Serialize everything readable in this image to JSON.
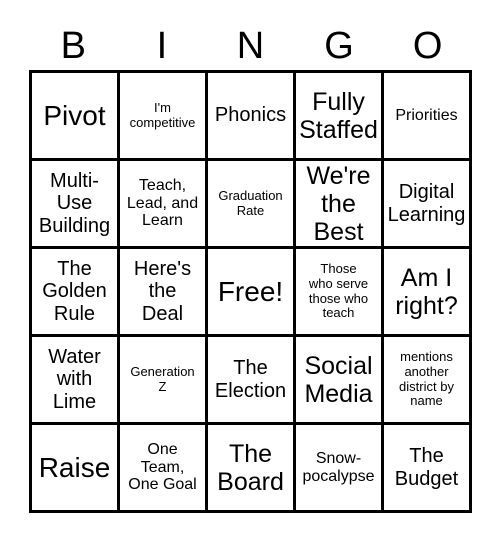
{
  "card": {
    "header_letters": [
      "B",
      "I",
      "N",
      "G",
      "O"
    ],
    "columns": 5,
    "rows": 5,
    "border_color": "#000000",
    "background_color": "#ffffff",
    "text_color": "#000000",
    "free_space_label": "Free!",
    "free_space_position": "N3"
  },
  "cells": [
    {
      "id": "B1",
      "text": "Pivot",
      "size": "fs-xl"
    },
    {
      "id": "I1",
      "text": "I'm\ncompetitive",
      "size": "fs-xs"
    },
    {
      "id": "N1",
      "text": "Phonics",
      "size": "fs-md"
    },
    {
      "id": "G1",
      "text": "Fully\nStaffed",
      "size": "fs-lg"
    },
    {
      "id": "O1",
      "text": "Priorities",
      "size": "fs-sm"
    },
    {
      "id": "B2",
      "text": "Multi-\nUse\nBuilding",
      "size": "fs-md"
    },
    {
      "id": "I2",
      "text": "Teach,\nLead, and\nLearn",
      "size": "fs-sm"
    },
    {
      "id": "N2",
      "text": "Graduation\nRate",
      "size": "fs-xs"
    },
    {
      "id": "G2",
      "text": "We're\nthe\nBest",
      "size": "fs-lg"
    },
    {
      "id": "O2",
      "text": "Digital\nLearning",
      "size": "fs-md"
    },
    {
      "id": "B3",
      "text": "The\nGolden\nRule",
      "size": "fs-md"
    },
    {
      "id": "I3",
      "text": "Here's\nthe\nDeal",
      "size": "fs-md"
    },
    {
      "id": "N3",
      "text": "Free!",
      "size": "fs-xl"
    },
    {
      "id": "G3",
      "text": "Those\nwho serve\nthose who\nteach",
      "size": "fs-xs"
    },
    {
      "id": "O3",
      "text": "Am I\nright?",
      "size": "fs-lg"
    },
    {
      "id": "B4",
      "text": "Water\nwith\nLime",
      "size": "fs-md"
    },
    {
      "id": "I4",
      "text": "Generation\nZ",
      "size": "fs-xs"
    },
    {
      "id": "N4",
      "text": "The\nElection",
      "size": "fs-md"
    },
    {
      "id": "G4",
      "text": "Social\nMedia",
      "size": "fs-lg"
    },
    {
      "id": "O4",
      "text": "mentions\nanother\ndistrict by\nname",
      "size": "fs-xs"
    },
    {
      "id": "B5",
      "text": "Raise",
      "size": "fs-xl"
    },
    {
      "id": "I5",
      "text": "One\nTeam,\nOne Goal",
      "size": "fs-sm"
    },
    {
      "id": "N5",
      "text": "The\nBoard",
      "size": "fs-lg"
    },
    {
      "id": "G5",
      "text": "Snow-\npocalypse",
      "size": "fs-sm"
    },
    {
      "id": "O5",
      "text": "The\nBudget",
      "size": "fs-md"
    }
  ]
}
